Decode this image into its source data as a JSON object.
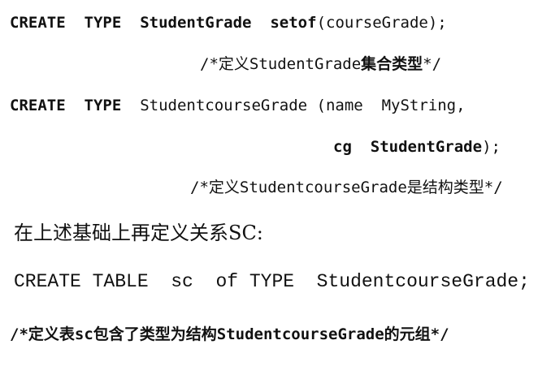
{
  "line1": {
    "kw_create": "CREATE",
    "kw_type": "TYPE",
    "name": "StudentGrade",
    "kw_setof": "setof",
    "rest": "(courseGrade);"
  },
  "line2": {
    "comment_a": "/*定义StudentGrade",
    "comment_b": "集合类型",
    "comment_c": "*/"
  },
  "line3": {
    "kw_create": "CREATE",
    "kw_type": "TYPE",
    "rest": "StudentcourseGrade (name  MyString,"
  },
  "line4": {
    "cg": "cg",
    "type": "StudentGrade",
    "rest": ");"
  },
  "line5": {
    "comment": "/*定义StudentcourseGrade是结构类型*/"
  },
  "line6": {
    "text": "在上述基础上再定义关系SC:"
  },
  "line7": {
    "text": "CREATE TABLE  sc  of TYPE  StudentcourseGrade;"
  },
  "line8": {
    "comment": "/*定义表sc包含了类型为结构StudentcourseGrade的元组*/"
  }
}
